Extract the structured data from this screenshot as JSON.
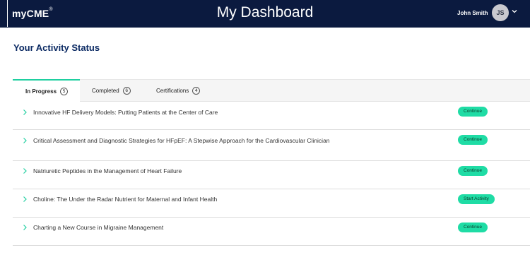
{
  "header": {
    "logo_text": "myCME",
    "logo_mark": "®",
    "title": "My Dashboard",
    "user_name": "John Smith",
    "avatar_initials": "JS"
  },
  "section_title": "Your Activity Status",
  "tabs": [
    {
      "label": "In Progress",
      "count": "5",
      "active": true
    },
    {
      "label": "Completed",
      "count": "6",
      "active": false
    },
    {
      "label": "Certifications",
      "count": "4",
      "active": false
    }
  ],
  "activities": [
    {
      "title": "Innovative HF Delivery Models: Putting Patients at the Center of Care",
      "action": "Continue"
    },
    {
      "title": "Critical Assessment and Diagnostic Strategies for HFpEF: A Stepwise Approach for the Cardiovascular Clinician",
      "action": "Continue"
    },
    {
      "title": "Natriuretic Peptides in the Management of Heart Failure",
      "action": "Continue"
    },
    {
      "title": "Choline: The Under the Radar Nutrient for Maternal and Infant Health",
      "action": "Start Activity"
    },
    {
      "title": "Charting a New Course in Migraine Management",
      "action": "Continue"
    }
  ],
  "colors": {
    "header_bg": "#0b1a3f",
    "title_blue": "#0b2a63",
    "accent_green": "#1fdca5"
  }
}
